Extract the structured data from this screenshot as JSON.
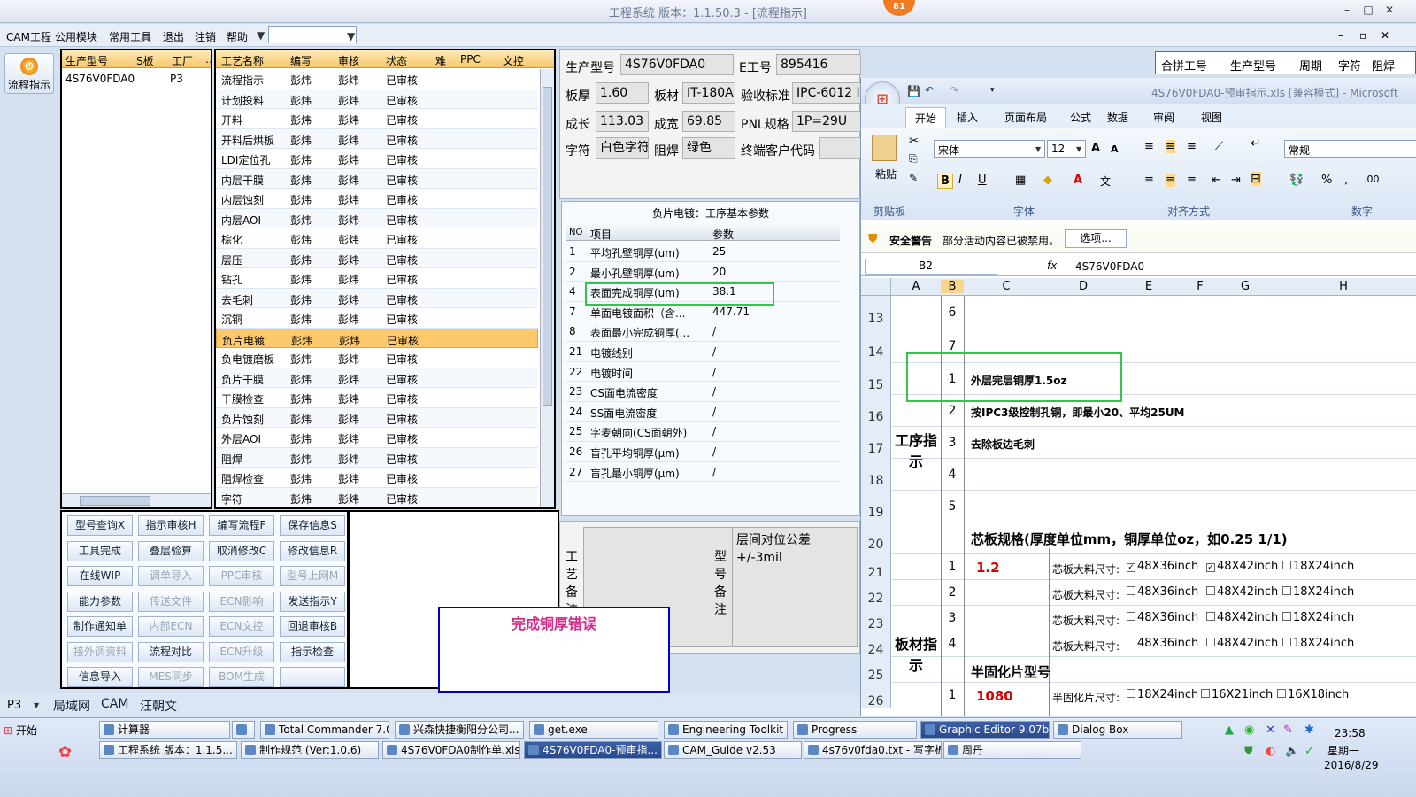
{
  "window": {
    "title": "工程系统  版本：1.1.50.3 - [流程指示]",
    "badge": "81"
  },
  "menu": [
    "CAM工程",
    "公用模块",
    "常用工具",
    "退出",
    "注销",
    "帮助"
  ],
  "left": {
    "big_button": "流程指示",
    "cols": [
      "生产型号",
      "S板",
      "工厂",
      "…"
    ],
    "row": [
      "4S76V0FDA0",
      "",
      "P3"
    ]
  },
  "flow": {
    "cols": [
      "工艺名称",
      "编写",
      "审核",
      "状态",
      "难",
      "PPC",
      "文控"
    ],
    "rows": [
      [
        "流程指示",
        "彭炜",
        "彭炜",
        "已审核"
      ],
      [
        "计划投料",
        "彭炜",
        "彭炜",
        "已审核"
      ],
      [
        "开料",
        "彭炜",
        "彭炜",
        "已审核"
      ],
      [
        "开料后烘板",
        "彭炜",
        "彭炜",
        "已审核"
      ],
      [
        "LDI定位孔",
        "彭炜",
        "彭炜",
        "已审核"
      ],
      [
        "内层干膜",
        "彭炜",
        "彭炜",
        "已审核"
      ],
      [
        "内层蚀刻",
        "彭炜",
        "彭炜",
        "已审核"
      ],
      [
        "内层AOI",
        "彭炜",
        "彭炜",
        "已审核"
      ],
      [
        "棕化",
        "彭炜",
        "彭炜",
        "已审核"
      ],
      [
        "层压",
        "彭炜",
        "彭炜",
        "已审核"
      ],
      [
        "钻孔",
        "彭炜",
        "彭炜",
        "已审核"
      ],
      [
        "去毛刺",
        "彭炜",
        "彭炜",
        "已审核"
      ],
      [
        "沉铜",
        "彭炜",
        "彭炜",
        "已审核"
      ],
      [
        "负片电镀",
        "彭炜",
        "彭炜",
        "已审核"
      ],
      [
        "负电镀磨板",
        "彭炜",
        "彭炜",
        "已审核"
      ],
      [
        "负片干膜",
        "彭炜",
        "彭炜",
        "已审核"
      ],
      [
        "干膜检查",
        "彭炜",
        "彭炜",
        "已审核"
      ],
      [
        "负片蚀刻",
        "彭炜",
        "彭炜",
        "已审核"
      ],
      [
        "外层AOI",
        "彭炜",
        "彭炜",
        "已审核"
      ],
      [
        "阻焊",
        "彭炜",
        "彭炜",
        "已审核"
      ],
      [
        "阻焊检查",
        "彭炜",
        "彭炜",
        "已审核"
      ],
      [
        "字符",
        "彭炜",
        "彭炜",
        "已审核"
      ]
    ]
  },
  "buttons": [
    [
      "型号查询X",
      "指示审核H",
      "编写流程F",
      "保存信息S"
    ],
    [
      "工具完成",
      "叠层验算",
      "取消修改C",
      "修改信息R"
    ],
    [
      "在线WIP",
      "调单导入",
      "PPC审核",
      "型号上网M"
    ],
    [
      "能力参数",
      "传送文件",
      "ECN影响",
      "发送指示Y"
    ],
    [
      "制作通知单",
      "内部ECN",
      "ECN文控",
      "回退审核B"
    ],
    [
      "接外调资料",
      "流程对比",
      "ECN升级",
      "指示检查"
    ],
    [
      "信息导入",
      "MES同步",
      "BOM生成",
      ""
    ]
  ],
  "info": {
    "l_model": "生产型号",
    "model": "4S76V0FDA0",
    "l_e": "E工号",
    "e": "895416",
    "l_thick": "板厚",
    "thick": "1.60",
    "l_mat": "板材",
    "mat": "IT-180A",
    "l_std": "验收标准",
    "std": "IPC-6012 I",
    "l_len": "成长",
    "len": "113.03",
    "l_wid": "成宽",
    "wid": "69.85",
    "l_pnl": "PNL规格",
    "pnl": "1P=29U",
    "l_char": "字符",
    "char": "白色字符",
    "l_mask": "阻焊",
    "mask": "绿色",
    "l_cust": "终端客户代码",
    "cust": ""
  },
  "params": {
    "title": "负片电镀：工序基本参数",
    "cols": [
      "NO",
      "项目",
      "参数"
    ],
    "rows": [
      [
        "1",
        "平均孔壁铜厚(um)",
        "25"
      ],
      [
        "2",
        "最小孔壁铜厚(um)",
        "20"
      ],
      [
        "4",
        "表面完成铜厚(um)",
        "38.1"
      ],
      [
        "7",
        "单面电镀面积（含...",
        "447.71"
      ],
      [
        "8",
        "表面最小完成铜厚(...",
        "/"
      ],
      [
        "21",
        "电镀线别",
        "/"
      ],
      [
        "22",
        "电镀时间",
        "/"
      ],
      [
        "23",
        "CS面电流密度",
        "/"
      ],
      [
        "24",
        "SS面电流密度",
        "/"
      ],
      [
        "25",
        "字麦朝向(CS面朝外)",
        "/"
      ],
      [
        "26",
        "盲孔平均铜厚(μm)",
        "/"
      ],
      [
        "27",
        "盲孔最小铜厚(μm)",
        "/"
      ]
    ]
  },
  "notes": {
    "proc_label": "工艺备注",
    "model_label": "型号备注",
    "model_text": "层间对位公差+/-3mil"
  },
  "error_msg": "完成铜厚错误",
  "topright_cols": [
    "合拼工号",
    "生产型号",
    "周期",
    "字符",
    "阻焊"
  ],
  "excel": {
    "title": "4S76V0FDA0-预审指示.xls [兼容模式] - Microsoft",
    "tabs": [
      "开始",
      "插入",
      "页面布局",
      "公式",
      "数据",
      "审阅",
      "视图"
    ],
    "font": "宋体",
    "size": "12",
    "fmt": "常规",
    "groups": [
      "剪贴板",
      "字体",
      "对齐方式",
      "数字"
    ],
    "paste": "粘贴",
    "security": "安全警告",
    "security_msg": "部分活动内容已被禁用。",
    "options": "选项...",
    "cellref": "B2",
    "formula": "4S76V0FDA0",
    "cols": [
      "A",
      "B",
      "C",
      "D",
      "E",
      "F",
      "G",
      "H"
    ],
    "rownums": [
      "13",
      "14",
      "15",
      "16",
      "17",
      "18",
      "19",
      "20",
      "21",
      "22",
      "23",
      "24",
      "25",
      "26"
    ],
    "gx_label": "工序指示",
    "bc_label": "板材指示",
    "items": [
      "6",
      "7",
      "1",
      "2",
      "3",
      "4",
      "5"
    ],
    "texts": [
      "",
      "",
      "外层完层铜厚1.5oz",
      "按IPC3级控制孔铜，即最小20、平均25UM",
      "去除板边毛刺",
      "",
      ""
    ],
    "core_title": "芯板规格(厚度单位mm，铜厚单位oz，如0.25 1/1)",
    "core_rows": [
      "1",
      "2",
      "3",
      "4"
    ],
    "core_val": "1.2",
    "core_lbl": "芯板大料尺寸:",
    "sizes": [
      "48X36inch",
      "48X42inch",
      "18X24inch"
    ],
    "pp_title": "半固化片型号",
    "pp_no": "1",
    "pp_val": "1080",
    "pp_lbl": "半固化片尺寸:",
    "pp_sizes": [
      "18X24inch",
      "16X21inch",
      "16X18inch"
    ]
  },
  "status": {
    "p3": "P3",
    "tabs": [
      "局域网",
      "CAM",
      "汪朝文"
    ]
  },
  "taskbar": {
    "start": "开始",
    "row1": [
      "计算器",
      "",
      "Total Commander 7.0 ...",
      "兴森快捷衡阳分公司...",
      "get.exe",
      "Engineering Toolkit 9.0...",
      "Progress",
      "Graphic Editor 9.07b2 (...",
      "Dialog Box"
    ],
    "row2": [
      "工程系统  版本：1.1.5...",
      "制作规范 (Ver:1.0.6)",
      "4S76V0FDA0制作单.xls ...",
      "4S76V0FDA0-预审指...",
      "CAM_Guide v2.53",
      "4s76v0fda0.txt - 写字板",
      "周丹"
    ],
    "time": "23:58",
    "day": "星期一",
    "date": "2016/8/29"
  }
}
